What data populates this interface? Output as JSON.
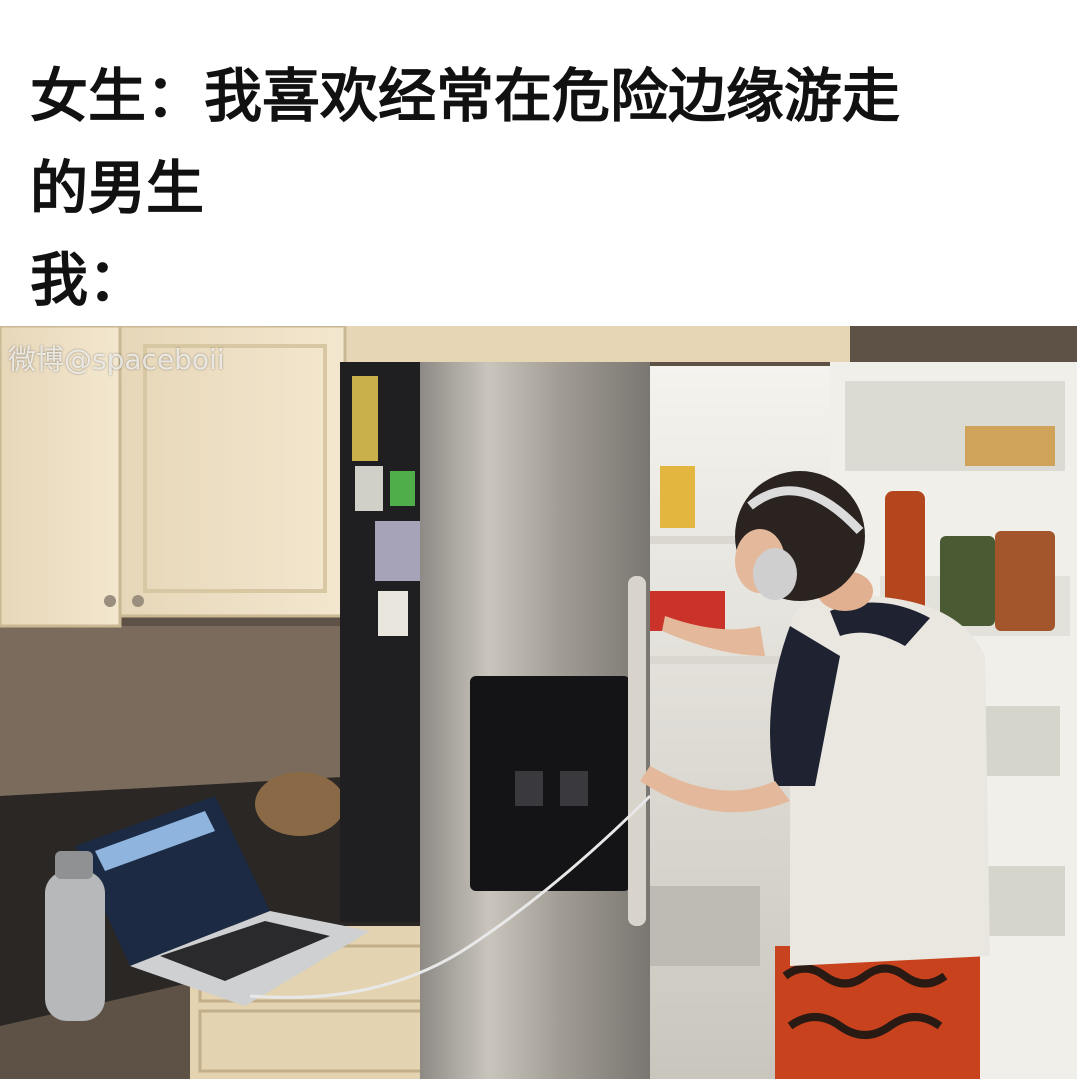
{
  "caption": {
    "line1": "女生：我喜欢经常在危险边缘游走",
    "line2": "的男生",
    "line3": "我："
  },
  "watermark": "微博@spaceboii",
  "colors": {
    "background": "#ffffff",
    "text": "#111111",
    "cabinet": "#efe2c8",
    "fridge_steel": "#a9a49c",
    "fridge_dark": "#1f1f22",
    "shorts": "#c8421e"
  }
}
